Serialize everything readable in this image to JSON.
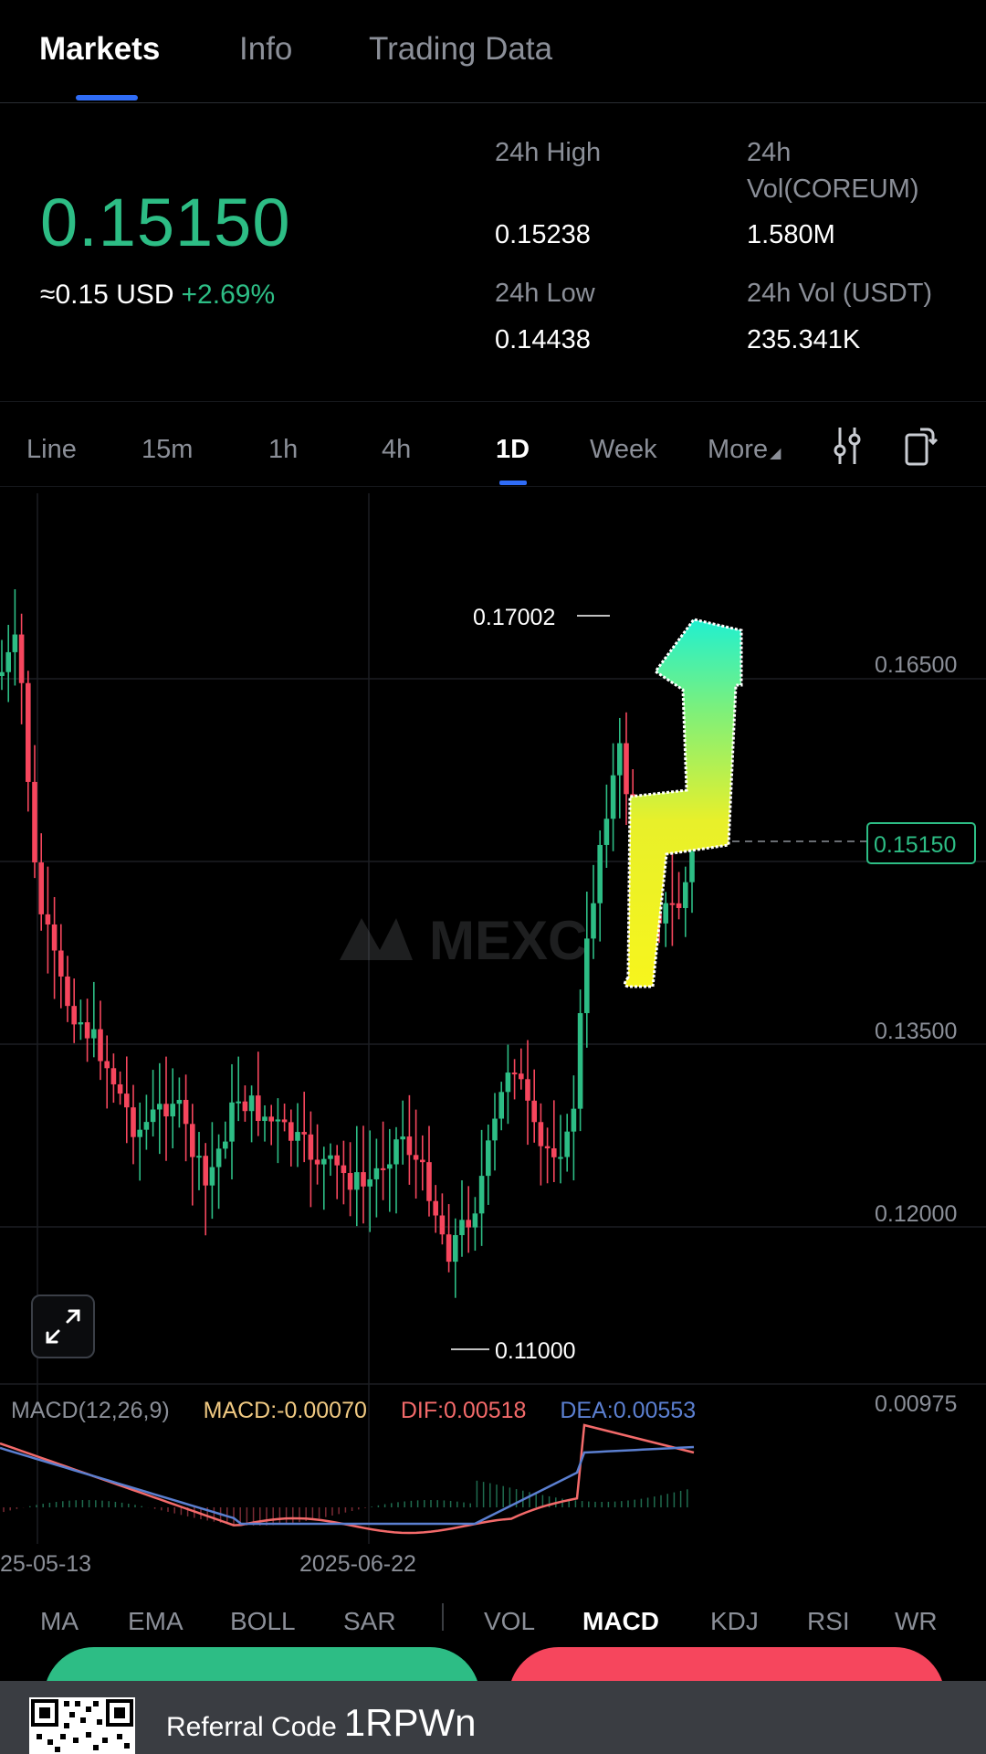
{
  "tabs": [
    {
      "label": "Markets",
      "active": true
    },
    {
      "label": "Info",
      "active": false
    },
    {
      "label": "Trading Data",
      "active": false
    }
  ],
  "price": {
    "last": "0.15150",
    "usd": "≈0.15 USD",
    "change": "+2.69%",
    "color_up": "#2dbd85"
  },
  "stats": {
    "high_label": "24h High",
    "high_value": "0.15238",
    "low_label": "24h Low",
    "low_value": "0.14438",
    "vol_base_label": "24h Vol(COREUM)",
    "vol_base_value": "1.580M",
    "vol_quote_label": "24h Vol (USDT)",
    "vol_quote_value": "235.341K"
  },
  "intervals": [
    "Line",
    "15m",
    "1h",
    "4h",
    "1D",
    "Week",
    "More"
  ],
  "active_interval": "1D",
  "icons": {
    "settings": "sliders-icon",
    "orientation": "rotate-device-icon",
    "expand": "expand-icon"
  },
  "chart_data": {
    "type": "candlestick",
    "y_axis_ticks": [
      "0.16500",
      "0.13500",
      "0.12000",
      "0.00975"
    ],
    "current_price_label": "0.15150",
    "high_marker": "0.17002",
    "low_marker": "0.11000",
    "x_axis_ticks": [
      "25-05-13",
      "2025-06-22"
    ],
    "watermark": "MEXC",
    "colors": {
      "up": "#2dbd85",
      "down": "#f6465d"
    }
  },
  "macd": {
    "label": "MACD(12,26,9)",
    "macd": "MACD:-0.00070",
    "dif": "DIF:0.00518",
    "dea": "DEA:0.00553"
  },
  "indicators": [
    "MA",
    "EMA",
    "BOLL",
    "SAR",
    "VOL",
    "MACD",
    "KDJ",
    "RSI",
    "WR"
  ],
  "active_indicator": "MACD",
  "referral": {
    "label": "Referral Code",
    "code": "1RPWn"
  }
}
